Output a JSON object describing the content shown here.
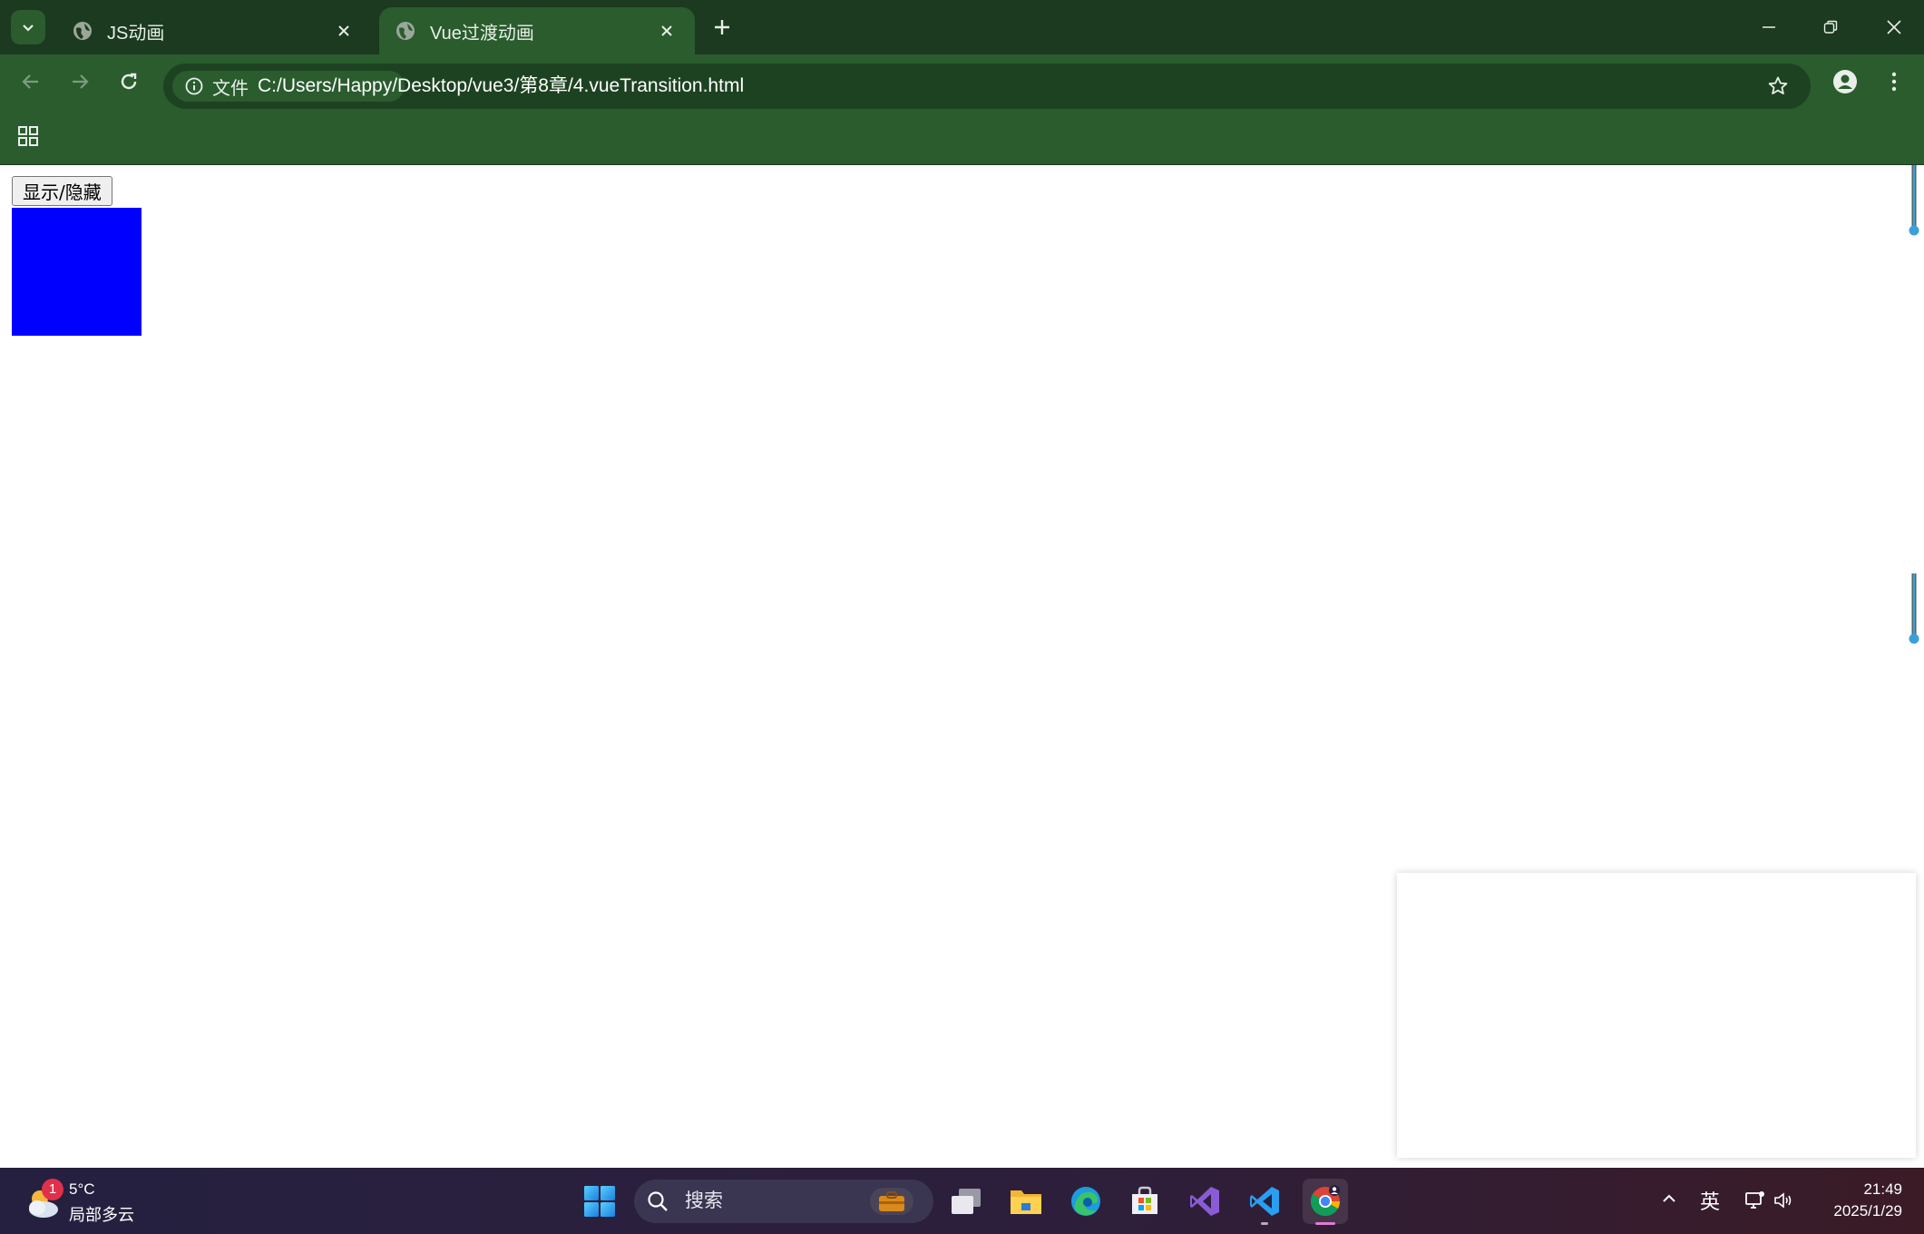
{
  "browser": {
    "tabs": [
      {
        "title": "JS动画",
        "active": false
      },
      {
        "title": "Vue过渡动画",
        "active": true
      }
    ],
    "address_bar": {
      "security_label": "文件",
      "url": "C:/Users/Happy/Desktop/vue3/第8章/4.vueTransition.html"
    }
  },
  "page": {
    "toggle_button": "显示/隐藏",
    "box_color": "#0000ff"
  },
  "taskbar": {
    "weather": {
      "badge": "1",
      "temp": "5°C",
      "condition": "局部多云"
    },
    "search_placeholder": "搜索",
    "ime": "英",
    "time": "21:49",
    "date": "2025/1/29",
    "apps": [
      "task-view",
      "file-explorer",
      "edge",
      "microsoft-store",
      "visual-studio",
      "vscode",
      "chrome"
    ]
  },
  "colors": {
    "titlebar": "#1b3a1f",
    "toolbar": "#2a5c2e",
    "accent_scroll": "#3aa0d8"
  }
}
